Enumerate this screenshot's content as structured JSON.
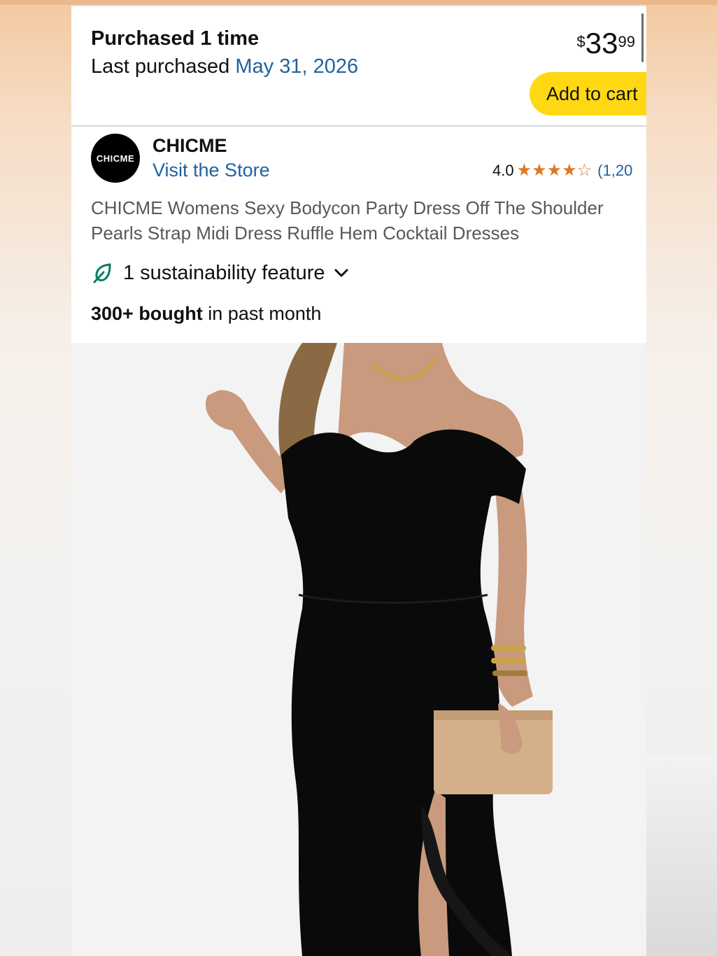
{
  "purchase": {
    "count_text": "Purchased 1 time",
    "last_label": "Last purchased ",
    "last_date": "May 31, 2026",
    "price_symbol": "$",
    "price_whole": "33",
    "price_fraction": "99",
    "add_to_cart_label": "Add to cart"
  },
  "brand": {
    "logo_text": "CHICME",
    "name": "CHICME",
    "visit_store_label": "Visit the Store",
    "rating_value": "4.0",
    "rating_stars": 4,
    "review_count": "(1,20"
  },
  "product": {
    "title": "CHICME Womens Sexy Bodycon Party Dress Off The Shoulder Pearls Strap Midi Dress Ruffle Hem Cocktail Dresses",
    "sustainability_label": "1 sustainability feature",
    "bought_bold": "300+ bought",
    "bought_rest": " in past month",
    "image_alt_icon": "product-photo"
  },
  "colors": {
    "link": "#2162a1",
    "cart_button": "#ffd814",
    "star": "#de7921",
    "leaf": "#067d62"
  }
}
